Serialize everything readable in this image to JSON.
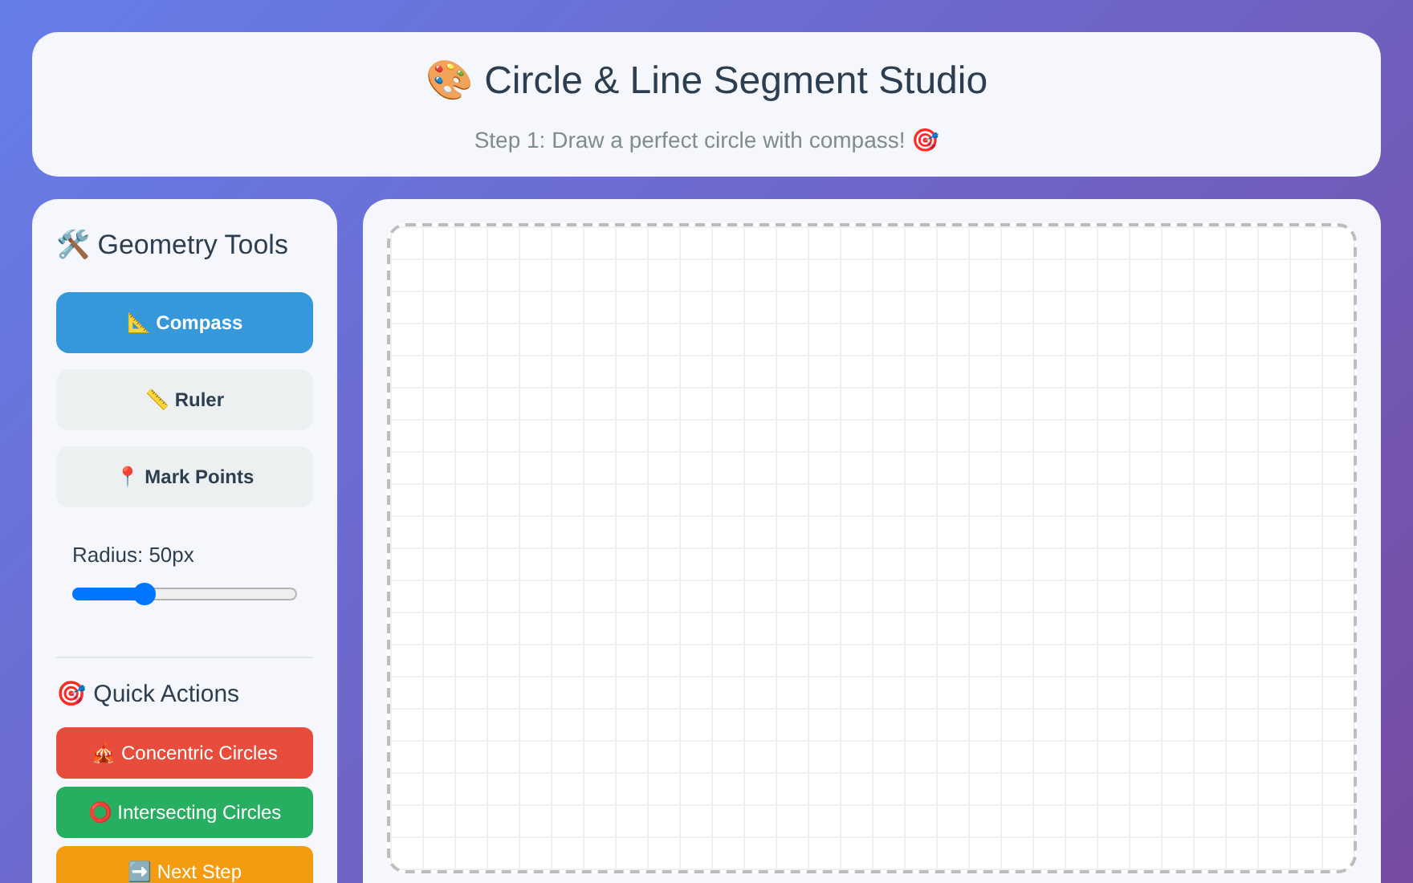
{
  "header": {
    "title": "🎨 Circle & Line Segment Studio",
    "subtitle": "Step 1: Draw a perfect circle with compass! 🎯"
  },
  "sidebar": {
    "title": "🛠️ Geometry Tools",
    "tools": [
      {
        "label": "📐 Compass",
        "selected": true
      },
      {
        "label": "📏 Ruler",
        "selected": false
      },
      {
        "label": "📍 Mark Points",
        "selected": false
      }
    ],
    "radius": {
      "label": "Radius: 50px",
      "level": 0.32
    },
    "quick_actions_title": "🎯 Quick Actions",
    "quick_actions": [
      {
        "label": "🎪 Concentric Circles",
        "color": "#e74c3c"
      },
      {
        "label": "⭕ Intersecting Circles",
        "color": "#27ae60"
      },
      {
        "label": "➡️ Next Step",
        "color": "#f39c12"
      }
    ]
  }
}
